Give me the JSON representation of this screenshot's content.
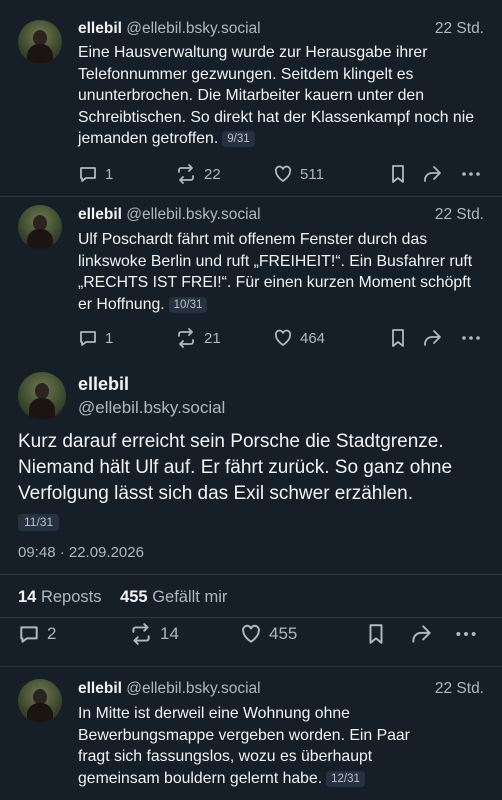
{
  "posts": [
    {
      "name": "ellebil",
      "handle": "@ellebil.bsky.social",
      "time": "22 Std.",
      "text": "Eine Hausverwaltung wurde zur Herausgabe ihrer Telefonnummer gezwungen. Seitdem klingelt es ununterbrochen. Die Mitarbeiter kauern unter den Schreibtischen. So direkt hat der Klassenkampf noch nie jemanden getroffen.",
      "badge": "9/31",
      "replies": "1",
      "reposts": "22",
      "likes": "511"
    },
    {
      "name": "ellebil",
      "handle": "@ellebil.bsky.social",
      "time": "22 Std.",
      "text": "Ulf Poschardt fährt mit offenem Fenster durch das linkswoke Berlin und ruft „FREIHEIT!“. Ein Busfahrer ruft „RECHTS IST FREI!“. Für einen kurzen Moment schöpft er Hoffnung.",
      "badge": "10/31",
      "replies": "1",
      "reposts": "21",
      "likes": "464"
    },
    {
      "name": "ellebil",
      "handle": "@ellebil.bsky.social",
      "time": "22 Std.",
      "text": "In Mitte ist derweil eine Wohnung ohne Bewerbungsmappe vergeben worden. Ein Paar fragt sich fassungslos, wozu es überhaupt gemeinsam bouldern gelernt habe.",
      "badge": "12/31"
    }
  ],
  "main_post": {
    "name": "ellebil",
    "handle": "@ellebil.bsky.social",
    "text": "Kurz darauf erreicht sein Porsche die Stadtgrenze. Niemand hält Ulf auf. Er fährt zurück. So ganz ohne Verfolgung lässt sich das Exil schwer erzählen.",
    "badge": "11/31",
    "datetime": "09:48 · 22.09.2026",
    "reposts_count": "14",
    "reposts_label": "Reposts",
    "likes_count": "455",
    "likes_label": "Gefällt mir",
    "replies": "2",
    "reposts": "14",
    "likes": "455"
  },
  "icons": [
    "reply-icon",
    "repost-icon",
    "like-icon",
    "bookmark-icon",
    "share-icon",
    "more-icon"
  ]
}
